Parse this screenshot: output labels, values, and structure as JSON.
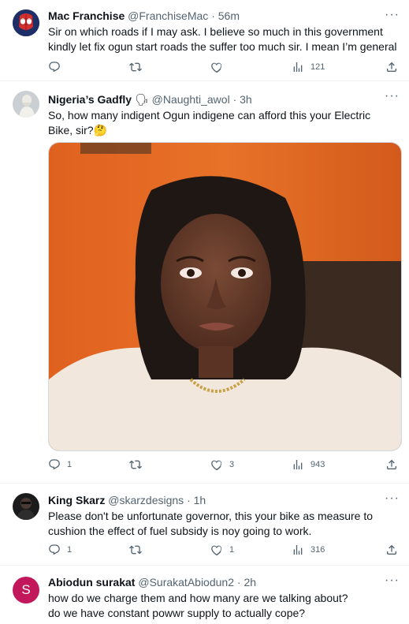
{
  "tweets": [
    {
      "name": "Mac Franchise",
      "handle": "@FranchiseMac",
      "time": "56m",
      "text": "Sir on which roads if I may ask. I believe so much in this government kindly let fix ogun start roads the suffer too much sir. I mean I’m general",
      "replies": "",
      "retweets": "",
      "likes": "",
      "views": "121",
      "avatar_icon": "spiderman-avatar"
    },
    {
      "name": "Nigeria’s Gadfly",
      "name_emoji": "🗣",
      "handle": "@Naughti_awol",
      "time": "3h",
      "text": "So, how many indigent Ogun indigene can afford this your Electric Bike, sir?🤔",
      "replies": "1",
      "retweets": "",
      "likes": "3",
      "views": "943",
      "avatar_icon": "statue-avatar"
    },
    {
      "name": "King Skarz",
      "handle": "@skarzdesigns",
      "time": "1h",
      "text": "Please don't be unfortunate governor, this your bike as measure to cushion the effect of fuel subsidy is noy going to work.",
      "replies": "1",
      "retweets": "",
      "likes": "1",
      "views": "316",
      "avatar_icon": "person-avatar"
    },
    {
      "name": "Abiodun surakat",
      "handle": "@SurakatAbiodun2",
      "time": "2h",
      "text": "how do we charge them and how many are we talking about?\ndo we have constant powwr supply to actually cope?",
      "avatar_letter": "S",
      "avatar_color": "#c2185b"
    }
  ],
  "more_glyph": "···",
  "separator": "·",
  "colors": {
    "secondary_text": "#536471",
    "border": "#eff3f4"
  }
}
